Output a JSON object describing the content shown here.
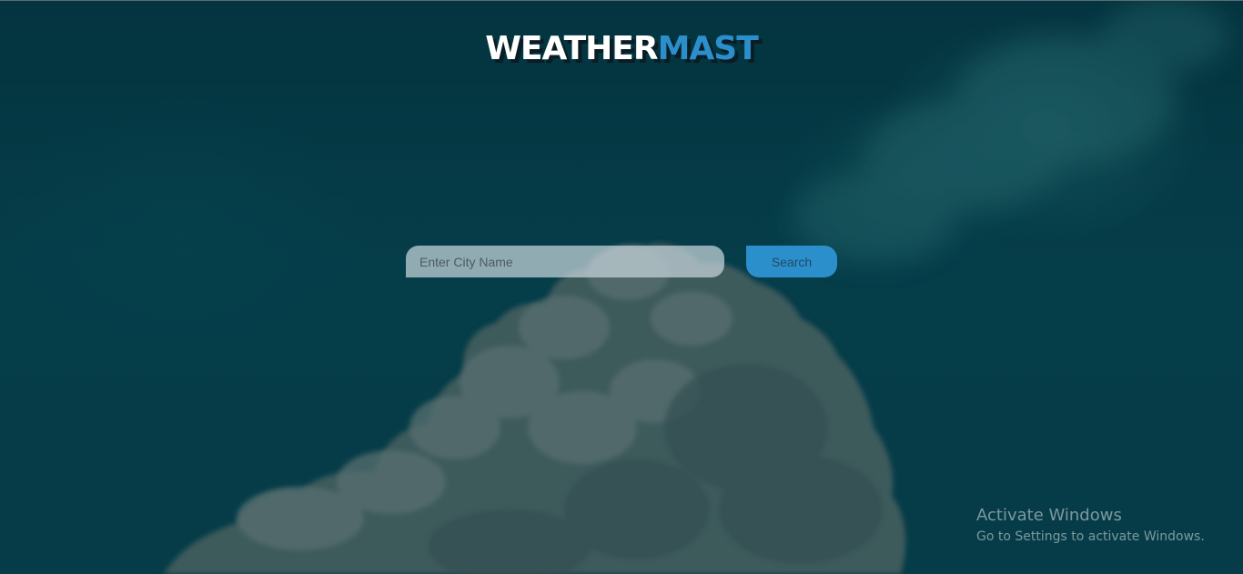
{
  "app": {
    "logo_part1": "WEATHER",
    "logo_part2": "MAST"
  },
  "search": {
    "placeholder": "Enter City Name",
    "value": "",
    "button_label": "Search"
  },
  "watermark": {
    "title": "Activate Windows",
    "subtitle": "Go to Settings to activate Windows."
  },
  "colors": {
    "accent": "#2b8fcc",
    "background": "#053a46",
    "logo_primary": "#ffffff"
  }
}
